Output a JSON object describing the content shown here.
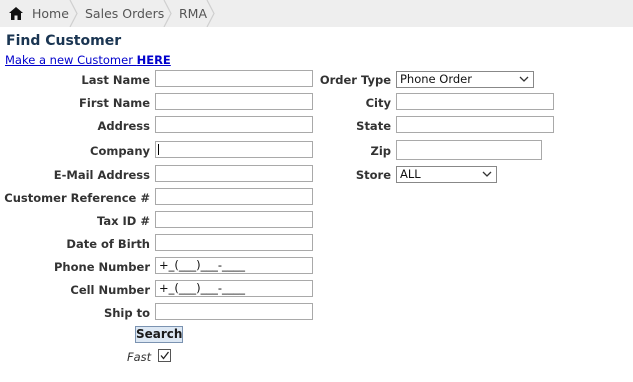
{
  "breadcrumb": {
    "home": "Home",
    "sales_orders": "Sales Orders",
    "rma": "RMA"
  },
  "page": {
    "title": "Find Customer",
    "new_customer_prefix": "Make a new Customer ",
    "new_customer_here": "HERE"
  },
  "form": {
    "last_name_label": "Last Name",
    "first_name_label": "First Name",
    "address_label": "Address",
    "company_label": "Company",
    "email_label": "E-Mail Address",
    "customer_ref_label": "Customer Reference #",
    "tax_id_label": "Tax ID #",
    "dob_label": "Date of Birth",
    "phone_label": "Phone Number",
    "phone_value": "+_(___)___-____",
    "cell_label": "Cell Number",
    "cell_value": "+_(___)___-____",
    "ship_to_label": "Ship to",
    "order_type_label": "Order Type",
    "order_type_value": "Phone Order",
    "city_label": "City",
    "state_label": "State",
    "zip_label": "Zip",
    "store_label": "Store",
    "store_value": "ALL",
    "search_label": "Search",
    "fast_label": "Fast",
    "fast_checked": true
  }
}
